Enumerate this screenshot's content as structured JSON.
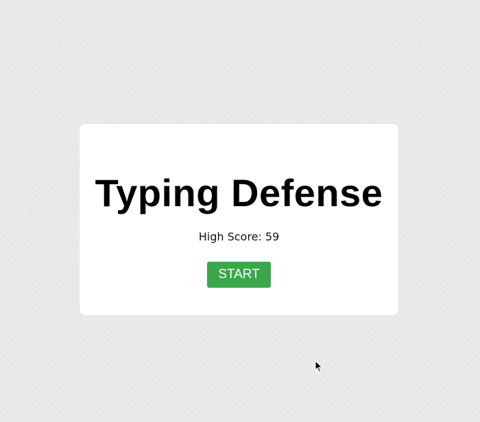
{
  "game": {
    "title": "Typing Defense",
    "high_score_label": "High Score: 59",
    "start_label": "START"
  },
  "colors": {
    "start_button": "#3aa84a",
    "card_background": "#ffffff",
    "page_background": "#eeeeee"
  },
  "icons": {
    "cursor": "mouse-pointer-icon"
  }
}
